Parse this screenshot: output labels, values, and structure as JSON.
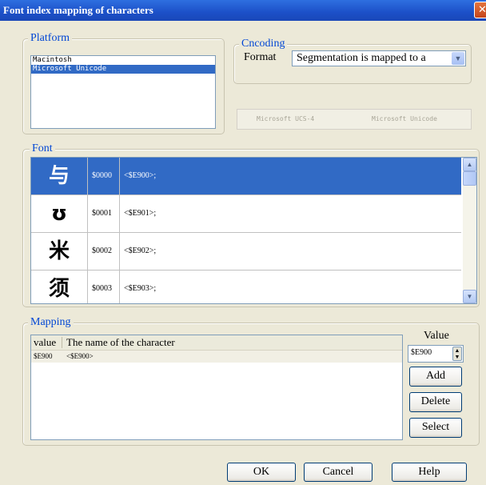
{
  "window": {
    "title": "Font index mapping of characters",
    "close_glyph": "✕"
  },
  "platform": {
    "legend": "Platform",
    "items": [
      {
        "label": "Macintosh",
        "selected": false
      },
      {
        "label": "Microsoft Unicode",
        "selected": true
      }
    ]
  },
  "encoding": {
    "legend": "Cncoding",
    "format_label": "Format",
    "format_value": "Segmentation is mapped to a",
    "chevron_icon": "chevron-down-icon",
    "disabled_items": [
      "Microsoft UCS-4",
      "Microsoft Unicode"
    ]
  },
  "font": {
    "legend": "Font",
    "rows": [
      {
        "glyph": "与",
        "code": "$0000",
        "name": "<$E900>;",
        "selected": true
      },
      {
        "glyph": "ʊ",
        "code": "$0001",
        "name": "<$E901>;",
        "selected": false
      },
      {
        "glyph": "米",
        "code": "$0002",
        "name": "<$E902>;",
        "selected": false
      },
      {
        "glyph": "须",
        "code": "$0003",
        "name": "<$E903>;",
        "selected": false
      }
    ]
  },
  "mapping": {
    "legend": "Mapping",
    "columns": [
      "value",
      "The name of the character"
    ],
    "rows": [
      {
        "value": "$E900",
        "name": "<$E900>"
      }
    ],
    "value_label": "Value",
    "value_input": "$E900",
    "buttons": {
      "add": "Add",
      "delete": "Delete",
      "select": "Select"
    }
  },
  "footer": {
    "ok": "OK",
    "cancel": "Cancel",
    "help": "Help"
  },
  "colors": {
    "selection": "#316ac5",
    "titlebar": "#1c50c8",
    "legend": "#0046d5"
  }
}
